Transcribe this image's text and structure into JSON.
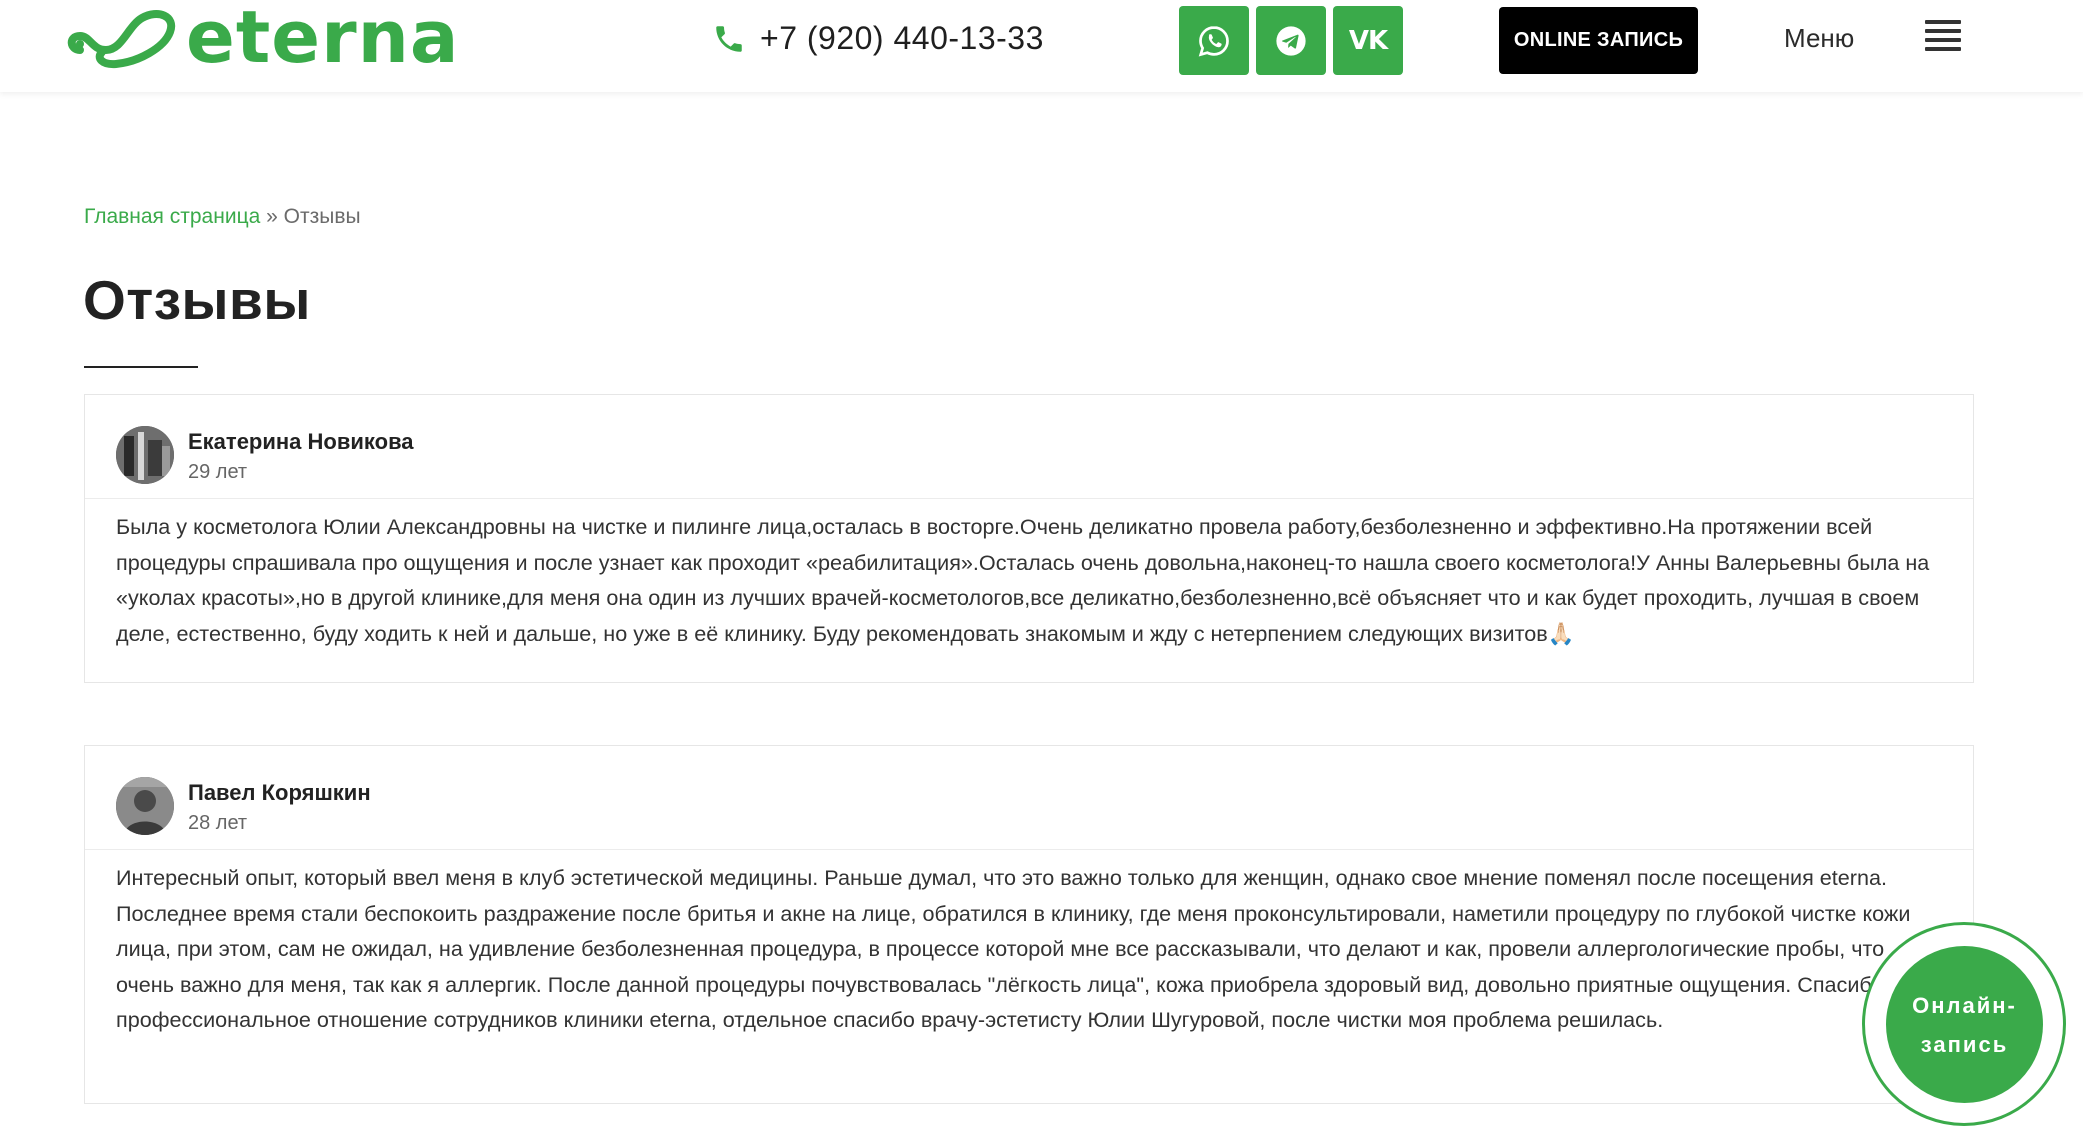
{
  "colors": {
    "brand": "#3aaa4a",
    "dark": "#000000",
    "text": "#2b2b2b"
  },
  "header": {
    "logo_text": "eterna",
    "phone": "+7 (920) 440-13-33",
    "social": [
      {
        "icon": "whatsapp-icon"
      },
      {
        "icon": "telegram-icon"
      },
      {
        "icon": "vk-icon",
        "text": "VK"
      }
    ],
    "online_button": "ONLINE ЗАПИСЬ",
    "menu_label": "Меню"
  },
  "breadcrumb": {
    "home": "Главная страница",
    "separator": " » ",
    "current": "Отзывы"
  },
  "page_title": "Отзывы",
  "reviews": [
    {
      "author": "Екатерина Новикова",
      "age": "29 лет",
      "text": "Была у косметолога Юлии Александровны на чистке и пилинге лица,осталась в восторге.Очень деликатно провела работу,безболезненно и эффективно.На протяжении всей процедуры спрашивала про ощущения и после узнает как проходит «реабилитация».Осталась очень довольна,наконец-то нашла своего косметолога!У Анны Валерьевны была на «уколах красоты»,но в другой клинике,для меня она один из лучших врачей-косметологов,все деликатно,безболезненно,всё объясняет что и как будет проходить, лучшая в своем деле, естественно, буду ходить к ней и дальше, но уже в её клинику. Буду рекомендовать знакомым и жду с нетерпением следующих визитов🙏🏻"
    },
    {
      "author": "Павел Коряшкин",
      "age": "28 лет",
      "text": "Интересный опыт, который ввел меня в клуб эстетической медицины. Раньше думал, что это важно только для женщин, однако свое мнение поменял после посещения eterna. Последнее время стали беспокоить раздражение после бритья и акне на лице, обратился в клинику, где меня проконсультировали, наметили процедуру по глубокой чистке кожи лица, при этом, сам не ожидал, на удивление безболезненная процедура, в процессе которой мне все рассказывали, что делают и как, провели аллергологические пробы, что очень важно для меня, так как я аллергик. После данной процедуры почувствовалась \"лёгкость лица\", кожа приобрела здоровый вид, довольно приятные ощущения. Спасибо за профессиональное отношение сотрудников клиники eterna, отдельное спасибо врачу-эстетисту Юлии Шугуровой, после чистки моя проблема решилась."
    }
  ],
  "floating_button": {
    "line1": "Онлайн-",
    "line2": "запись"
  }
}
